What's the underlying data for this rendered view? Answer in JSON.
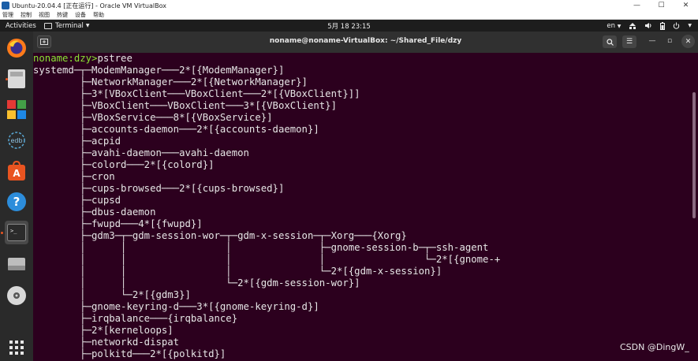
{
  "vbox": {
    "title": "Ubuntu-20.04.4 [正在运行] - Oracle VM VirtualBox",
    "menu": [
      "管理",
      "控制",
      "视图",
      "热键",
      "设备",
      "帮助"
    ],
    "controls": {
      "minimize": "—",
      "maximize": "☐",
      "close": "✕"
    }
  },
  "topbar": {
    "activities": "Activities",
    "app_menu": "Terminal",
    "clock": "5月 18  23:15",
    "input_method": "en",
    "tray_icons": [
      "network-icon",
      "volume-icon",
      "battery-icon",
      "power-icon"
    ]
  },
  "dock": [
    "firefox-icon",
    "files-icon",
    "software-icon",
    "edb-icon",
    "ubuntu-software-icon",
    "help-icon",
    "terminal-icon",
    "disk-icon",
    "dvd-icon",
    "show-apps-icon"
  ],
  "terminal": {
    "title": "noname@noname-VirtualBox: ~/Shared_File/dzy",
    "prompt": "noname:dzy>",
    "command": "pstree",
    "lines": [
      "systemd─┬─ModemManager───2*[{ModemManager}]",
      "        ├─NetworkManager───2*[{NetworkManager}]",
      "        ├─3*[VBoxClient───VBoxClient───2*[{VBoxClient}]]",
      "        ├─VBoxClient───VBoxClient───3*[{VBoxClient}]",
      "        ├─VBoxService───8*[{VBoxService}]",
      "        ├─accounts-daemon───2*[{accounts-daemon}]",
      "        ├─acpid",
      "        ├─avahi-daemon───avahi-daemon",
      "        ├─colord───2*[{colord}]",
      "        ├─cron",
      "        ├─cups-browsed───2*[{cups-browsed}]",
      "        ├─cupsd",
      "        ├─dbus-daemon",
      "        ├─fwupd───4*[{fwupd}]",
      "        ├─gdm3─┬─gdm-session-wor─┬─gdm-x-session─┬─Xorg───{Xorg}",
      "        │      │                 │               ├─gnome-session-b─┬─ssh-agent",
      "        │      │                 │               │                 └─2*[{gnome-+",
      "        │      │                 │               └─2*[{gdm-x-session}]",
      "        │      │                 └─2*[{gdm-session-wor}]",
      "        │      └─2*[{gdm3}]",
      "        ├─gnome-keyring-d───3*[{gnome-keyring-d}]",
      "        ├─irqbalance───{irqbalance}",
      "        ├─2*[kerneloops]",
      "        ├─networkd-dispat",
      "        ├─polkitd───2*[{polkitd}]"
    ]
  },
  "watermark": "CSDN @DingW_"
}
